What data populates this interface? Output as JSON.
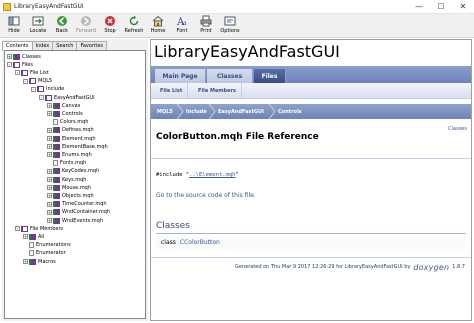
{
  "window": {
    "title": "LibraryEasyAndFastGUI",
    "min_symbol": "—",
    "max_symbol": "☐",
    "close_symbol": "✕"
  },
  "toolbar": [
    {
      "label": "Hide",
      "icon": "hide-icon",
      "enabled": true
    },
    {
      "label": "Locate",
      "icon": "locate-icon",
      "enabled": true
    },
    {
      "label": "Back",
      "icon": "back-icon",
      "enabled": true
    },
    {
      "label": "Forward",
      "icon": "forward-icon",
      "enabled": false
    },
    {
      "label": "Stop",
      "icon": "stop-icon",
      "enabled": true
    },
    {
      "label": "Refresh",
      "icon": "refresh-icon",
      "enabled": true
    },
    {
      "label": "Home",
      "icon": "home-icon",
      "enabled": true
    },
    {
      "label": "Font",
      "icon": "font-icon",
      "enabled": true
    },
    {
      "label": "Print",
      "icon": "print-icon",
      "enabled": true
    },
    {
      "label": "Options",
      "icon": "options-icon",
      "enabled": true
    }
  ],
  "nav_tabs": [
    "Contents",
    "Index",
    "Search",
    "Favorites"
  ],
  "tree": [
    {
      "label": "Classes",
      "depth": 0,
      "expander": "+",
      "icon": "book"
    },
    {
      "label": "Files",
      "depth": 0,
      "expander": "-",
      "icon": "obook"
    },
    {
      "label": "File List",
      "depth": 1,
      "expander": "-",
      "icon": "obook"
    },
    {
      "label": "MQL5",
      "depth": 2,
      "expander": "-",
      "icon": "obook"
    },
    {
      "label": "Include",
      "depth": 3,
      "expander": "-",
      "icon": "obook"
    },
    {
      "label": "EasyAndFastGUI",
      "depth": 4,
      "expander": "-",
      "icon": "obook"
    },
    {
      "label": "Canvas",
      "depth": 5,
      "expander": "+",
      "icon": "book"
    },
    {
      "label": "Controls",
      "depth": 5,
      "expander": "+",
      "icon": "book"
    },
    {
      "label": "Colors.mqh",
      "depth": 5,
      "expander": "",
      "icon": "doc"
    },
    {
      "label": "Defines.mqh",
      "depth": 5,
      "expander": "+",
      "icon": "book"
    },
    {
      "label": "Element.mqh",
      "depth": 5,
      "expander": "+",
      "icon": "book"
    },
    {
      "label": "ElementBase.mqh",
      "depth": 5,
      "expander": "+",
      "icon": "book"
    },
    {
      "label": "Enums.mqh",
      "depth": 5,
      "expander": "+",
      "icon": "book"
    },
    {
      "label": "Fonts.mqh",
      "depth": 5,
      "expander": "",
      "icon": "doc"
    },
    {
      "label": "KeyCodes.mqh",
      "depth": 5,
      "expander": "+",
      "icon": "book"
    },
    {
      "label": "Keys.mqh",
      "depth": 5,
      "expander": "+",
      "icon": "book"
    },
    {
      "label": "Mouse.mqh",
      "depth": 5,
      "expander": "+",
      "icon": "book"
    },
    {
      "label": "Objects.mqh",
      "depth": 5,
      "expander": "+",
      "icon": "book"
    },
    {
      "label": "TimeCounter.mqh",
      "depth": 5,
      "expander": "+",
      "icon": "book"
    },
    {
      "label": "WndContainer.mqh",
      "depth": 5,
      "expander": "+",
      "icon": "book"
    },
    {
      "label": "WndEvents.mqh",
      "depth": 5,
      "expander": "+",
      "icon": "book"
    },
    {
      "label": "File Members",
      "depth": 1,
      "expander": "-",
      "icon": "obook"
    },
    {
      "label": "All",
      "depth": 2,
      "expander": "+",
      "icon": "book"
    },
    {
      "label": "Enumerations",
      "depth": 2,
      "expander": "",
      "icon": "doc"
    },
    {
      "label": "Enumerator",
      "depth": 2,
      "expander": "",
      "icon": "doc"
    },
    {
      "label": "Macros",
      "depth": 2,
      "expander": "+",
      "icon": "book"
    }
  ],
  "page": {
    "project_title": "LibraryEasyAndFastGUI",
    "tabs": [
      "Main Page",
      "Classes",
      "Files"
    ],
    "active_tab": "Files",
    "subtabs": [
      "File List",
      "File Members"
    ],
    "breadcrumbs": [
      "MQL5",
      "Include",
      "EasyAndFastGUI",
      "Controls"
    ],
    "summary_link": "Classes",
    "header_title": "ColorButton.mqh File Reference",
    "include_prefix": "#include \"",
    "include_target": "..\\Element.mqh",
    "include_suffix": "\"",
    "source_link": "Go to the source code of this file.",
    "classes_heading": "Classes",
    "class_keyword": "class",
    "class_name": "CColorButton",
    "footer_text": "Generated on Thu Mar 9 2017 12:26:29 for LibraryEasyAndFastGUI by",
    "footer_logo": "doxygen",
    "footer_version": "1.8.7"
  },
  "colors": {
    "tab_active": "#3a4c82",
    "link": "#3d578c",
    "navpath": "#6f84b7"
  }
}
